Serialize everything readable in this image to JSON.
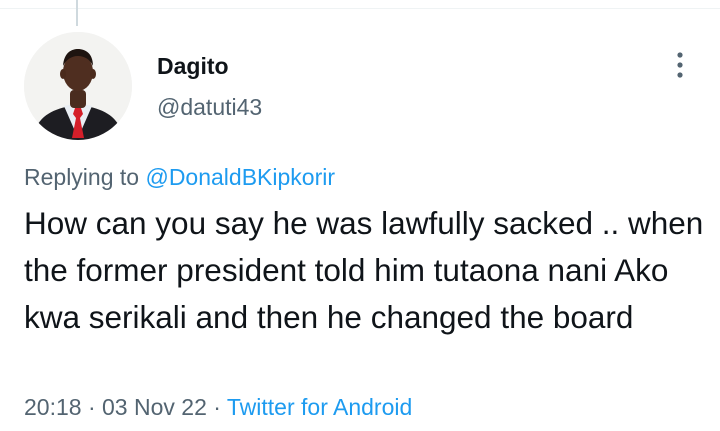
{
  "tweet": {
    "author_name": "Dagito",
    "author_handle": "@datuti43",
    "avatar_description": "man-in-suit-red-tie",
    "replying_to_prefix": "Replying to ",
    "replying_to_handle": "@DonaldBKipkorir",
    "text": "How can you say he was lawfully sacked .. when the former president told him tutaona nani Ako kwa serikali and then he changed the board",
    "time": "20:18",
    "separator": " · ",
    "date": "03 Nov 22",
    "source": "Twitter for Android"
  },
  "icons": {
    "more": "more-vertical-icon"
  },
  "colors": {
    "text_primary": "#0f1419",
    "text_secondary": "#536471",
    "link": "#1d9bf0",
    "divider": "#eff3f4"
  }
}
